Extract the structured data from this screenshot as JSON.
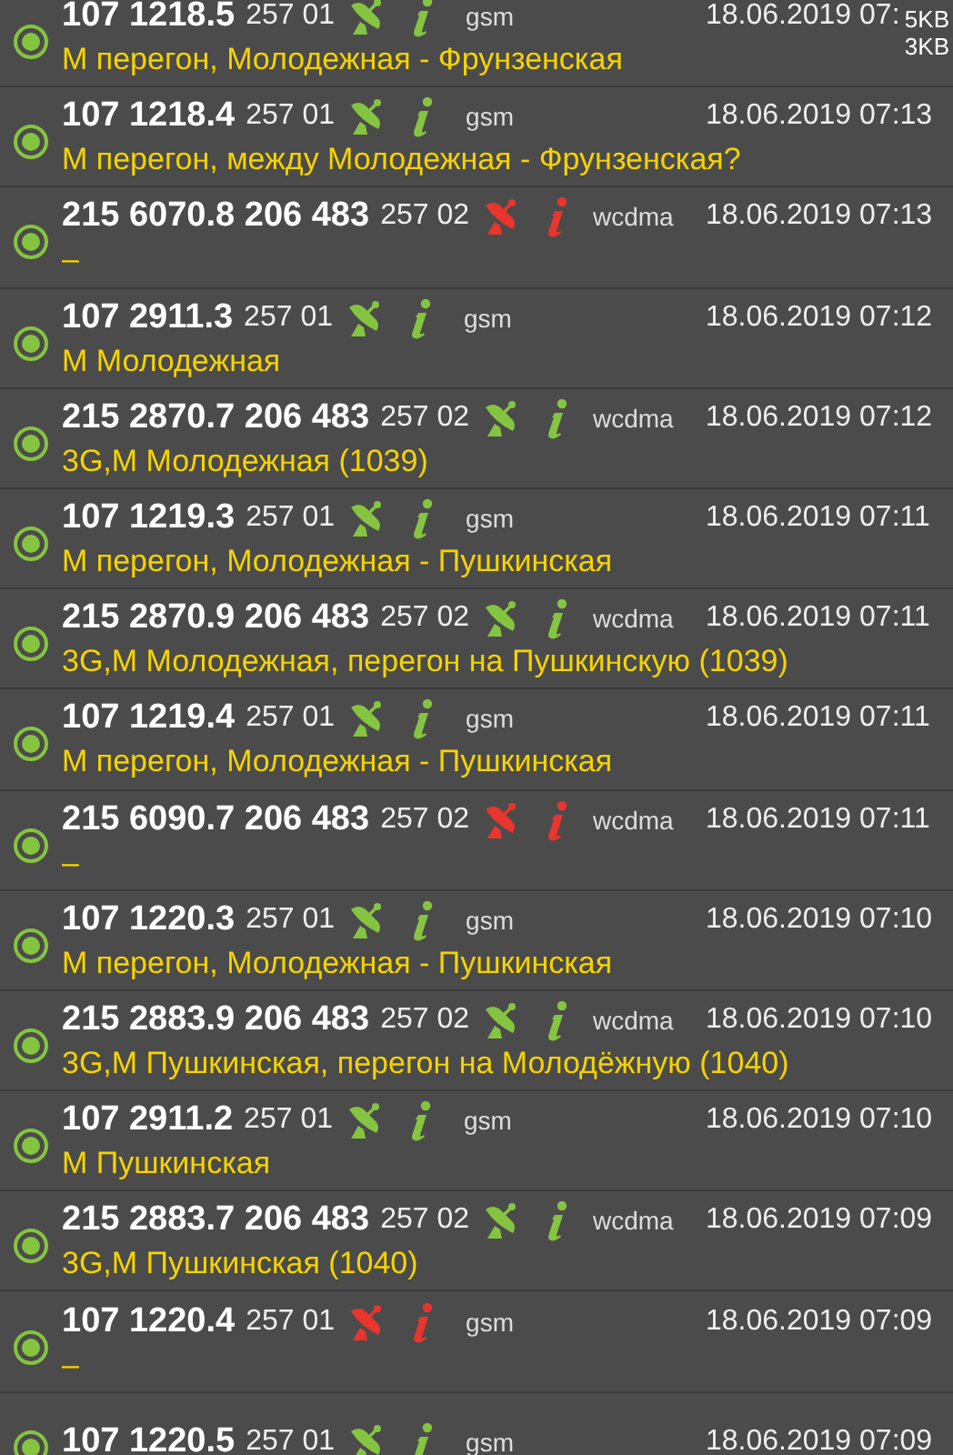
{
  "status_overlay": {
    "upload": "5KB",
    "download": "3KB"
  },
  "rows": [
    {
      "cell": "107 1218.5",
      "code": "257 01",
      "failed": false,
      "network": "gsm",
      "time": "18.06.2019 07:",
      "location": "М перегон, Молодежная - Фрунзенская"
    },
    {
      "cell": "107 1218.4",
      "code": "257 01",
      "failed": false,
      "network": "gsm",
      "time": "18.06.2019 07:13",
      "location": "М перегон, между Молодежная - Фрунзенская?"
    },
    {
      "cell": "215 6070.8 206 483",
      "code": "257 02",
      "failed": true,
      "network": "wcdma",
      "time": "18.06.2019 07:13",
      "location": "–"
    },
    {
      "cell": "107 2911.3",
      "code": "257 01",
      "failed": false,
      "network": "gsm",
      "time": "18.06.2019 07:12",
      "location": "М Молодежная"
    },
    {
      "cell": "215 2870.7 206 483",
      "code": "257 02",
      "failed": false,
      "network": "wcdma",
      "time": "18.06.2019 07:12",
      "location": "3G,М Молодежная (1039)"
    },
    {
      "cell": "107 1219.3",
      "code": "257 01",
      "failed": false,
      "network": "gsm",
      "time": "18.06.2019 07:11",
      "location": "М перегон, Молодежная - Пушкинская"
    },
    {
      "cell": "215 2870.9 206 483",
      "code": "257 02",
      "failed": false,
      "network": "wcdma",
      "time": "18.06.2019 07:11",
      "location": "3G,М Молодежная, перегон на Пушкинскую (1039)"
    },
    {
      "cell": "107 1219.4",
      "code": "257 01",
      "failed": false,
      "network": "gsm",
      "time": "18.06.2019 07:11",
      "location": "М перегон, Молодежная - Пушкинская"
    },
    {
      "cell": "215 6090.7 206 483",
      "code": "257 02",
      "failed": true,
      "network": "wcdma",
      "time": "18.06.2019 07:11",
      "location": "–"
    },
    {
      "cell": "107 1220.3",
      "code": "257 01",
      "failed": false,
      "network": "gsm",
      "time": "18.06.2019 07:10",
      "location": "М перегон, Молодежная - Пушкинская"
    },
    {
      "cell": "215 2883.9 206 483",
      "code": "257 02",
      "failed": false,
      "network": "wcdma",
      "time": "18.06.2019 07:10",
      "location": "3G,М Пушкинская, перегон на Молодёжную (1040)"
    },
    {
      "cell": "107 2911.2",
      "code": "257 01",
      "failed": false,
      "network": "gsm",
      "time": "18.06.2019 07:10",
      "location": "М Пушкинская"
    },
    {
      "cell": "215 2883.7 206 483",
      "code": "257 02",
      "failed": false,
      "network": "wcdma",
      "time": "18.06.2019 07:09",
      "location": "3G,М Пушкинская (1040)"
    },
    {
      "cell": "107 1220.4",
      "code": "257 01",
      "failed": true,
      "network": "gsm",
      "time": "18.06.2019 07:09",
      "location": "–"
    },
    {
      "cell": "107 1220.5",
      "code": "257 01",
      "failed": false,
      "network": "gsm",
      "time": "18.06.2019 07:09"
    }
  ]
}
